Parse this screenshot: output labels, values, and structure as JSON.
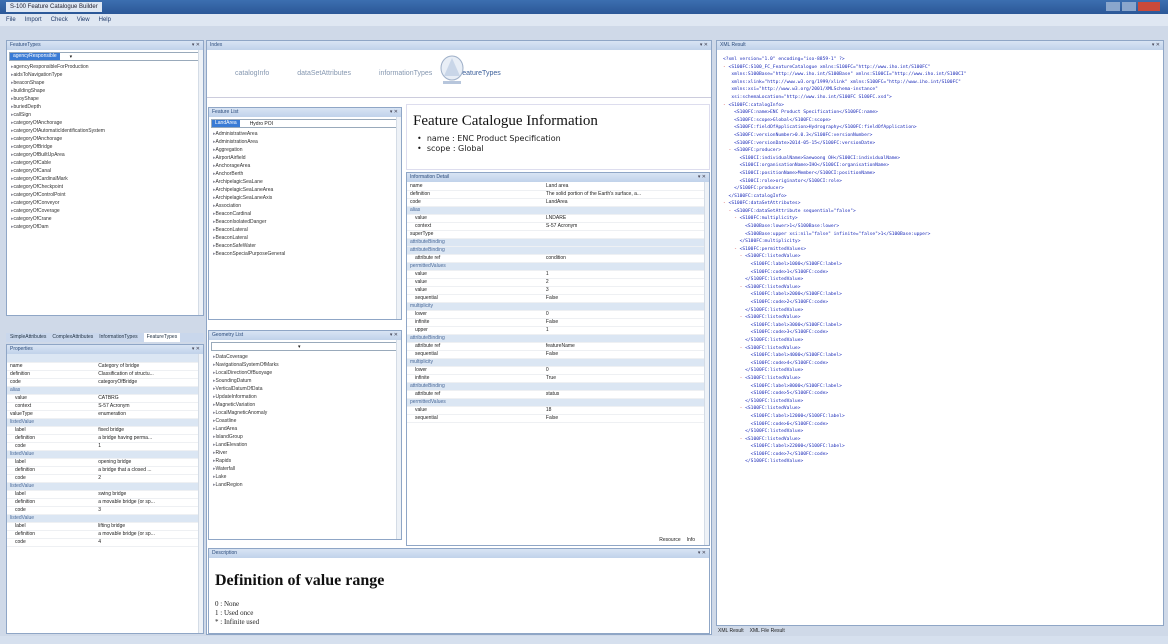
{
  "window": {
    "title": "S-100 Feature Catalogue Builder",
    "menu": [
      "File",
      "Import",
      "Check",
      "View",
      "Help"
    ]
  },
  "left_panel": {
    "header": "FeatureTypes",
    "combo": {
      "selected": "agencyResponsible",
      "value": ""
    },
    "items": [
      "agencyResponsibleForProduction",
      "aidsToNavigationType",
      "beaconShape",
      "buildingShape",
      "buoyShape",
      "buriedDepth",
      "callSign",
      "categoryOfAnchorage",
      "categoryOfAutomaticIdentificationSystem",
      "categoryOfAnchorage",
      "categoryOfBridge",
      "categoryOfBuiltUpArea",
      "categoryOfCable",
      "categoryOfCanal",
      "categoryOfCardinalMark",
      "categoryOfCheckpoint",
      "categoryOfControlPoint",
      "categoryOfConveyor",
      "categoryOfCoverage",
      "categoryOfCrane",
      "categoryOfDam"
    ],
    "tabs": [
      "SimpleAttributes",
      "ComplexAttributes",
      "InformationTypes",
      "FeatureTypes"
    ]
  },
  "properties_panel": {
    "header": "Properties",
    "rows": [
      {
        "k": "",
        "v": "",
        "group": true
      },
      {
        "k": "name",
        "v": "Category of bridge"
      },
      {
        "k": "definition",
        "v": "Classification of structu..."
      },
      {
        "k": "code",
        "v": "categoryOfBridge"
      },
      {
        "k": "alias",
        "v": "",
        "group": true
      },
      {
        "k": "value",
        "v": "CATBRG",
        "sub": true
      },
      {
        "k": "context",
        "v": "S-57 Acronym",
        "sub": true
      },
      {
        "k": "valueType",
        "v": "enumeration"
      },
      {
        "k": "listedValue",
        "v": "",
        "group": true
      },
      {
        "k": "label",
        "v": "fixed bridge",
        "sub": true
      },
      {
        "k": "definition",
        "v": "a bridge having perma...",
        "sub": true
      },
      {
        "k": "code",
        "v": "1",
        "sub": true
      },
      {
        "k": "listedValue",
        "v": "",
        "group": true
      },
      {
        "k": "label",
        "v": "opening bridge",
        "sub": true
      },
      {
        "k": "definition",
        "v": "a bridge that a closed ...",
        "sub": true
      },
      {
        "k": "code",
        "v": "2",
        "sub": true
      },
      {
        "k": "listedValue",
        "v": "",
        "group": true
      },
      {
        "k": "label",
        "v": "swing bridge",
        "sub": true
      },
      {
        "k": "definition",
        "v": "a movable bridge (or sp...",
        "sub": true
      },
      {
        "k": "code",
        "v": "3",
        "sub": true
      },
      {
        "k": "listedValue",
        "v": "",
        "group": true
      },
      {
        "k": "label",
        "v": "lifting bridge",
        "sub": true
      },
      {
        "k": "definition",
        "v": "a movable bridge (or sp...",
        "sub": true
      },
      {
        "k": "code",
        "v": "4",
        "sub": true
      }
    ]
  },
  "center": {
    "header": "Index",
    "tabs": [
      "catalogInfo",
      "dataSetAttributes",
      "informationTypes",
      "featureTypes"
    ],
    "feature_list": {
      "header": "Feature List",
      "combo": {
        "selected": "LandArea",
        "value": "Hydro POI"
      },
      "items": [
        "AdministrativeArea",
        "AdministrationArea",
        "Aggregation",
        "AirportAirfield",
        "AnchorageArea",
        "AnchorBerth",
        "ArchipelagicSeaLane",
        "ArchipelagicSeaLaneArea",
        "ArchipelagicSeaLaneAxis",
        "Association",
        "BeaconCardinal",
        "BeaconIsolatedDanger",
        "BeaconLateral",
        "BeaconLateral",
        "BeaconSafeWater",
        "BeaconSpecialPurposeGeneral"
      ]
    },
    "geometry_list": {
      "header": "Geometry List",
      "items": [
        "DataCoverage",
        "NavigationalSystemOfMarks",
        "LocalDirectionOfBuoyage",
        "SoundingDatum",
        "VerticalDatumOfData",
        "UpdateInformation",
        "MagneticVariation",
        "LocalMagneticAnomaly",
        "Coastline",
        "LandArea",
        "IslandGroup",
        "LandElevation",
        "River",
        "Rapids",
        "Waterfall",
        "Lake",
        "LandRegion"
      ]
    },
    "fci": {
      "title": "Feature Catalogue Information",
      "items": [
        "name : ENC Product Specification",
        "scope : Global"
      ]
    },
    "info": {
      "header": "Information Detail",
      "rows": [
        {
          "k": "name",
          "v": "Land area"
        },
        {
          "k": "definition",
          "v": "The solid portion of the Earth's surface, a..."
        },
        {
          "k": "code",
          "v": "LandArea"
        },
        {
          "k": "alias",
          "v": "",
          "group": true
        },
        {
          "k": "value",
          "v": "LNDARE",
          "sub": true
        },
        {
          "k": "context",
          "v": "S-57 Acronym",
          "sub": true
        },
        {
          "k": "superType",
          "v": ""
        },
        {
          "k": "attributeBinding",
          "v": "",
          "group": true
        },
        {
          "k": "attributeBinding",
          "v": "",
          "group": true
        },
        {
          "k": "attribute ref",
          "v": "condition",
          "sub": true
        },
        {
          "k": "permittedValues",
          "v": "",
          "group": true
        },
        {
          "k": "value",
          "v": "1",
          "sub": true
        },
        {
          "k": "value",
          "v": "2",
          "sub": true
        },
        {
          "k": "value",
          "v": "3",
          "sub": true
        },
        {
          "k": "sequential",
          "v": "False",
          "sub": true
        },
        {
          "k": "multiplicity",
          "v": "",
          "group": true
        },
        {
          "k": "lower",
          "v": "0",
          "sub": true
        },
        {
          "k": "infinite",
          "v": "False",
          "sub": true
        },
        {
          "k": "upper",
          "v": "1",
          "sub": true
        },
        {
          "k": "attributeBinding",
          "v": "",
          "group": true
        },
        {
          "k": "attribute ref",
          "v": "featureName",
          "sub": true
        },
        {
          "k": "sequential",
          "v": "False",
          "sub": true
        },
        {
          "k": "multiplicity",
          "v": "",
          "group": true
        },
        {
          "k": "lower",
          "v": "0",
          "sub": true
        },
        {
          "k": "infinite",
          "v": "True",
          "sub": true
        },
        {
          "k": "attributeBinding",
          "v": "",
          "group": true
        },
        {
          "k": "attribute ref",
          "v": "status",
          "sub": true
        },
        {
          "k": "permittedValues",
          "v": "",
          "group": true
        },
        {
          "k": "value",
          "v": "18",
          "sub": true
        },
        {
          "k": "sequential",
          "v": "False",
          "sub": true
        }
      ],
      "footer": [
        "Resource",
        "Info"
      ]
    },
    "description": {
      "header": "Description",
      "title": "Definition of value range",
      "items": [
        "0 : None",
        "1 : Used once",
        "* : Infinite used"
      ]
    }
  },
  "xml_panel": {
    "header": "XML Result",
    "lines": [
      [
        "",
        "<?xml version=\"1.0\" encoding=\"iso-8859-1\" ?>"
      ],
      [
        "- ",
        "<S100FC:S100_FC_FeatureCatalogue xmlns:S100FC=\"http://www.iho.int/S100FC\""
      ],
      [
        "   ",
        "xmlns:S100Base=\"http://www.iho.int/S100Base\" xmlns:S100CI=\"http://www.iho.int/S100CI\""
      ],
      [
        "   ",
        "xmlns:xlink=\"http://www.w3.org/1999/xlink\" xmlns:S100FC=\"http://www.iho.int/S100FC\""
      ],
      [
        "   ",
        "xmlns:xsi=\"http://www.w3.org/2001/XMLSchema-instance\""
      ],
      [
        "   ",
        "xsi:schemaLocation=\"http://www.iho.int/S100FC S100FC.xsd\">"
      ],
      [
        "- ",
        "<S100FC:catalogInfo>"
      ],
      [
        "    ",
        "<S100FC:name>ENC Product Specification</S100FC:name>"
      ],
      [
        "    ",
        "<S100FC:scope>Global</S100FC:scope>"
      ],
      [
        "    ",
        "<S100FC:fieldOfApplication>Hydrography</S100FC:fieldOfApplication>"
      ],
      [
        "    ",
        "<S100FC:versionNumber>0.0.3</S100FC:versionNumber>"
      ],
      [
        "    ",
        "<S100FC:versionDate>2014-05-15</S100FC:versionDate>"
      ],
      [
        "  - ",
        "<S100FC:producer>"
      ],
      [
        "      ",
        "<S100CI:individualName>Saewoong OH</S100CI:individualName>"
      ],
      [
        "      ",
        "<S100CI:organisationName>IHO</S100CI:organisationName>"
      ],
      [
        "      ",
        "<S100CI:positionName>Member</S100CI:positionName>"
      ],
      [
        "      ",
        "<S100CI:role>originator</S100CI:role>"
      ],
      [
        "    ",
        "</S100FC:producer>"
      ],
      [
        "  ",
        "</S100FC:catalogInfo>"
      ],
      [
        "- ",
        "<S100FC:dataSetAttributes>"
      ],
      [
        "  - ",
        "<S100FC:dataSetAttribute sequential=\"false\">"
      ],
      [
        "    - ",
        "<S100FC:multiplicity>"
      ],
      [
        "        ",
        "<S100Base:lower>1</S100Base:lower>"
      ],
      [
        "        ",
        "<S100Base:upper xsi:nil=\"false\" infinite=\"false\">1</S100Base:upper>"
      ],
      [
        "      ",
        "</S100FC:multiplicity>"
      ],
      [
        "    - ",
        "<S100FC:permittedValues>"
      ],
      [
        "      - ",
        "<S100FC:listedValue>"
      ],
      [
        "          ",
        "<S100FC:label>1000</S100FC:label>"
      ],
      [
        "          ",
        "<S100FC:code>1</S100FC:code>"
      ],
      [
        "        ",
        "</S100FC:listedValue>"
      ],
      [
        "      - ",
        "<S100FC:listedValue>"
      ],
      [
        "          ",
        "<S100FC:label>2000</S100FC:label>"
      ],
      [
        "          ",
        "<S100FC:code>2</S100FC:code>"
      ],
      [
        "        ",
        "</S100FC:listedValue>"
      ],
      [
        "      - ",
        "<S100FC:listedValue>"
      ],
      [
        "          ",
        "<S100FC:label>3000</S100FC:label>"
      ],
      [
        "          ",
        "<S100FC:code>3</S100FC:code>"
      ],
      [
        "        ",
        "</S100FC:listedValue>"
      ],
      [
        "      - ",
        "<S100FC:listedValue>"
      ],
      [
        "          ",
        "<S100FC:label>4000</S100FC:label>"
      ],
      [
        "          ",
        "<S100FC:code>4</S100FC:code>"
      ],
      [
        "        ",
        "</S100FC:listedValue>"
      ],
      [
        "      - ",
        "<S100FC:listedValue>"
      ],
      [
        "          ",
        "<S100FC:label>8000</S100FC:label>"
      ],
      [
        "          ",
        "<S100FC:code>5</S100FC:code>"
      ],
      [
        "        ",
        "</S100FC:listedValue>"
      ],
      [
        "      - ",
        "<S100FC:listedValue>"
      ],
      [
        "          ",
        "<S100FC:label>12000</S100FC:label>"
      ],
      [
        "          ",
        "<S100FC:code>6</S100FC:code>"
      ],
      [
        "        ",
        "</S100FC:listedValue>"
      ],
      [
        "      - ",
        "<S100FC:listedValue>"
      ],
      [
        "          ",
        "<S100FC:label>22000</S100FC:label>"
      ],
      [
        "          ",
        "<S100FC:code>7</S100FC:code>"
      ],
      [
        "        ",
        "</S100FC:listedValue>"
      ]
    ],
    "tabs": [
      "XML Result",
      "XML File Result"
    ]
  }
}
